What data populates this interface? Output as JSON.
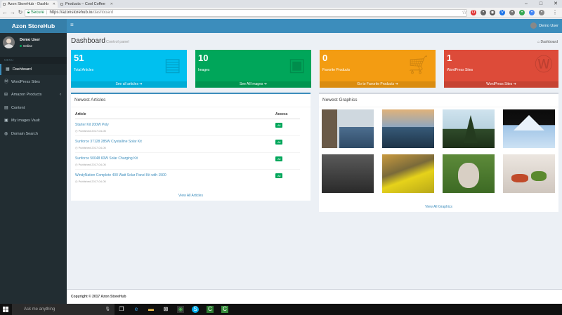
{
  "browser": {
    "tabs": [
      {
        "title": "Azon StoreHub - Dashb"
      },
      {
        "title": "Products – Cool Coffee"
      }
    ],
    "secure_label": "Secure",
    "url_host": "https://azonstorehub.io",
    "url_path": "/dashboard"
  },
  "app": {
    "logo": "Azon StoreHub",
    "user_name": "Demo User",
    "user_status": "Online",
    "menu_header": "MENU",
    "menu": [
      {
        "label": "Dashboard",
        "icon": "dashboard-icon"
      },
      {
        "label": "WordPress Sites",
        "icon": "wordpress-icon"
      },
      {
        "label": "Amazon Products",
        "icon": "cart-icon"
      },
      {
        "label": "Content",
        "icon": "document-icon"
      },
      {
        "label": "My Images Vault",
        "icon": "image-icon"
      },
      {
        "label": "Domain Search",
        "icon": "globe-icon"
      }
    ],
    "nav_user": "Demo User"
  },
  "header": {
    "title": "Dashboard",
    "subtitle": "Control panel",
    "breadcrumb": "Dashboard"
  },
  "stats": [
    {
      "value": "51",
      "label": "Total Articles",
      "link": "See all articles",
      "color": "#00c0ef"
    },
    {
      "value": "10",
      "label": "Images",
      "link": "See All Images",
      "color": "#00a65a"
    },
    {
      "value": "0",
      "label": "Favorite Products",
      "link": "Go to Favorite Products",
      "color": "#f39c12"
    },
    {
      "value": "1",
      "label": "WordPress Sites",
      "link": "WordPress Sites",
      "color": "#dd4b39"
    }
  ],
  "articles": {
    "title": "Newest Articles",
    "col_article": "Article",
    "col_access": "Access",
    "rows": [
      {
        "title": "Starter Kit 200W Poly",
        "date": "Published 2017-04-05",
        "badge": "All"
      },
      {
        "title": "Sunforce 37128 285W Crystalline Solar Kit",
        "date": "Published 2017-04-05",
        "badge": "All"
      },
      {
        "title": "Sunforce 50048 60W Solar Charging Kit",
        "date": "Published 2017-04-05",
        "badge": "All"
      },
      {
        "title": "WindyNation Complete 400 Watt Solar Panel Kit with 1500",
        "date": "Published 2017-04-05",
        "badge": "All"
      }
    ],
    "view_all": "View All Articles"
  },
  "graphics": {
    "title": "Newest Graphics",
    "view_all": "View All Graphics"
  },
  "footer": {
    "text": "Copyright © 2017 Azon StoreHub"
  },
  "taskbar": {
    "search_placeholder": "Ask me anything"
  }
}
